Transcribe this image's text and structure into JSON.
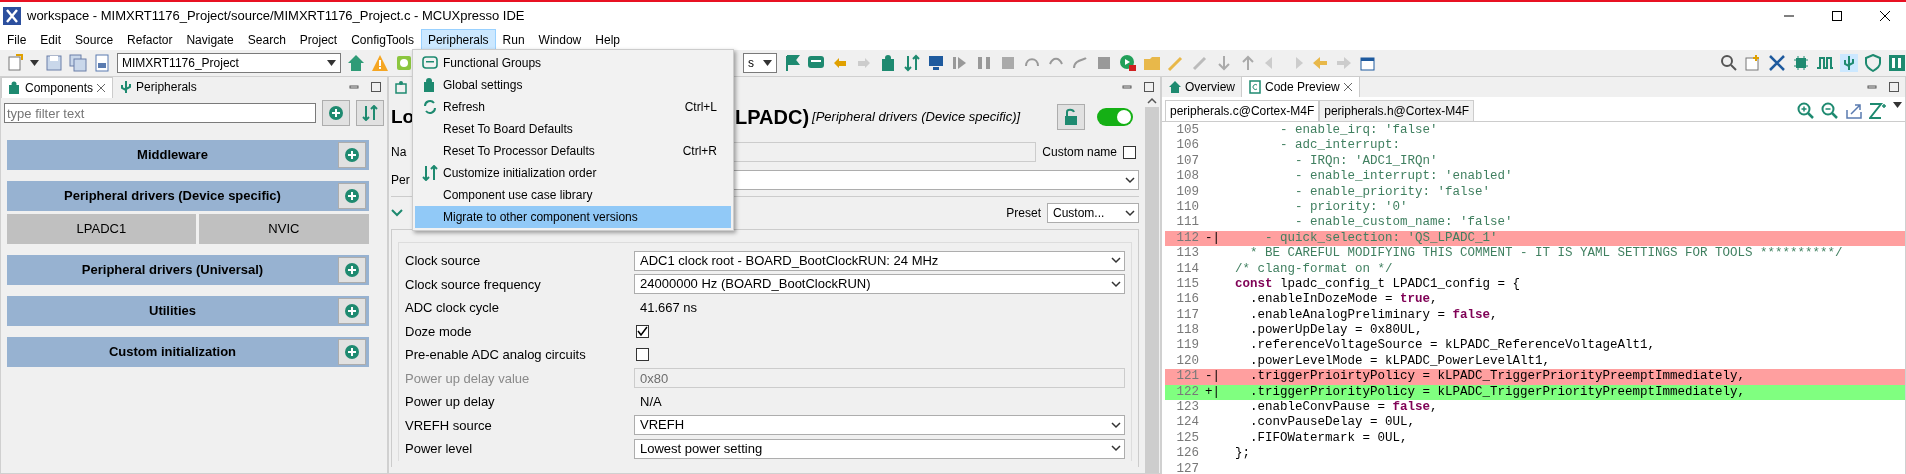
{
  "window": {
    "title": "workspace - MIMXRT1176_Project/source/MIMXRT1176_Project.c - MCUXpresso IDE"
  },
  "menu_bar": [
    {
      "label": "File",
      "selected": false
    },
    {
      "label": "Edit",
      "selected": false
    },
    {
      "label": "Source",
      "selected": false
    },
    {
      "label": "Refactor",
      "selected": false
    },
    {
      "label": "Navigate",
      "selected": false
    },
    {
      "label": "Search",
      "selected": false
    },
    {
      "label": "Project",
      "selected": false
    },
    {
      "label": "ConfigTools",
      "selected": false
    },
    {
      "label": "Peripherals",
      "selected": true
    },
    {
      "label": "Run",
      "selected": false
    },
    {
      "label": "Window",
      "selected": false
    },
    {
      "label": "Help",
      "selected": false
    }
  ],
  "toolbar": {
    "project_combo": "MIMXRT1176_Project",
    "second_combo": "s"
  },
  "open_menu": {
    "items": [
      {
        "label": "Functional Groups",
        "selected": false
      },
      {
        "label": "Global settings",
        "selected": false
      },
      {
        "label": "Refresh",
        "shortcut": "Ctrl+L",
        "selected": false
      },
      {
        "label": "Reset To Board Defaults",
        "selected": false
      },
      {
        "label": "Reset To Processor Defaults",
        "shortcut": "Ctrl+R",
        "selected": false
      },
      {
        "label": "Customize initialization order",
        "selected": false
      },
      {
        "label": "Component use case library",
        "selected": false
      },
      {
        "label": "Migrate to other component versions",
        "selected": true
      }
    ]
  },
  "components_view": {
    "tabs": [
      {
        "label": "Components",
        "selected": true
      },
      {
        "label": "Peripherals",
        "selected": false
      }
    ],
    "filter": {
      "placeholder": "type filter text"
    },
    "sections": [
      {
        "title": "Middleware"
      },
      {
        "title": "Peripheral drivers (Device specific)",
        "children": [
          {
            "label": "LPADC1"
          },
          {
            "label": "NVIC"
          }
        ]
      },
      {
        "title": "Peripheral drivers (Universal)"
      },
      {
        "title": "Utilities"
      },
      {
        "title": "Custom initialization"
      }
    ]
  },
  "editor": {
    "heading_start": "Lo",
    "heading_end": "LPADC)",
    "heading_category": "[Peripheral drivers (Device specific)]",
    "enabled": true,
    "name_label": "Na",
    "custom_name": {
      "label": "Custom name",
      "checked": false
    },
    "peripheral_label": "Per",
    "preset": {
      "label": "Preset",
      "value": "Custom..."
    },
    "settings": [
      {
        "kind": "select",
        "label": "Clock source",
        "value": "ADC1 clock root - BOARD_BootClockRUN: 24 MHz",
        "disabled": false
      },
      {
        "kind": "select",
        "label": "Clock source frequency",
        "value": "24000000 Hz (BOARD_BootClockRUN)",
        "disabled": false
      },
      {
        "kind": "text",
        "label": "ADC clock cycle",
        "value": "41.667 ns",
        "disabled": false
      },
      {
        "kind": "checkbox",
        "label": "Doze mode",
        "checked": true,
        "disabled": false
      },
      {
        "kind": "checkbox",
        "label": "Pre-enable ADC analog circuits",
        "checked": false,
        "disabled": false
      },
      {
        "kind": "input",
        "label": "Power up delay value",
        "value": "0x80",
        "disabled": true
      },
      {
        "kind": "text",
        "label": "Power up delay",
        "value": "N/A",
        "disabled": false
      },
      {
        "kind": "select",
        "label": "VREFH source",
        "value": "VREFH",
        "disabled": false
      },
      {
        "kind": "select",
        "label": "Power level",
        "value": "Lowest power setting",
        "disabled": false
      }
    ]
  },
  "code_preview": {
    "tabs": [
      {
        "label": "Overview",
        "selected": false
      },
      {
        "label": "Code Preview",
        "selected": true
      }
    ],
    "file_tabs": [
      {
        "label": "peripherals.c@Cortex-M4F",
        "selected": true
      },
      {
        "label": "peripherals.h@Cortex-M4F",
        "selected": false
      }
    ],
    "lines": [
      {
        "number": "105",
        "kind": "context",
        "parts": [
          {
            "text": "      - enable_irq: 'false'",
            "kind": "comment"
          }
        ]
      },
      {
        "number": "106",
        "kind": "context",
        "parts": [
          {
            "text": "      - adc_interrupt:",
            "kind": "comment"
          }
        ]
      },
      {
        "number": "107",
        "kind": "context",
        "parts": [
          {
            "text": "        - IRQn: 'ADC1_IRQn'",
            "kind": "comment"
          }
        ]
      },
      {
        "number": "108",
        "kind": "context",
        "parts": [
          {
            "text": "        - enable_interrupt: 'enabled'",
            "kind": "comment"
          }
        ]
      },
      {
        "number": "109",
        "kind": "context",
        "parts": [
          {
            "text": "        - enable_priority: 'false'",
            "kind": "comment"
          }
        ]
      },
      {
        "number": "110",
        "kind": "context",
        "parts": [
          {
            "text": "        - priority: '0'",
            "kind": "comment"
          }
        ]
      },
      {
        "number": "111",
        "kind": "context",
        "parts": [
          {
            "text": "        - enable_custom_name: 'false'",
            "kind": "comment"
          }
        ]
      },
      {
        "number": "112",
        "kind": "removed",
        "marker": "-|",
        "parts": [
          {
            "text": "    - quick_selection: 'QS_LPADC_1'",
            "kind": "comment"
          }
        ]
      },
      {
        "number": "113",
        "kind": "context",
        "parts": [
          {
            "text": "  * BE CAREFUL MODIFYING THIS COMMENT - IT IS YAML SETTINGS FOR TOOLS **********/",
            "kind": "comment"
          }
        ]
      },
      {
        "number": "114",
        "kind": "context",
        "parts": [
          {
            "text": "/* clang-format on */",
            "kind": "comment"
          }
        ]
      },
      {
        "number": "115",
        "kind": "context",
        "parts": [
          {
            "text": "const",
            "kind": "keyword"
          },
          {
            "text": " lpadc_config_t LPADC1_config = {",
            "kind": "plain"
          }
        ]
      },
      {
        "number": "116",
        "kind": "context",
        "parts": [
          {
            "text": "  .enableInDozeMode = ",
            "kind": "plain"
          },
          {
            "text": "true",
            "kind": "keyword"
          },
          {
            "text": ",",
            "kind": "plain"
          }
        ]
      },
      {
        "number": "117",
        "kind": "context",
        "parts": [
          {
            "text": "  .enableAnalogPreliminary = ",
            "kind": "plain"
          },
          {
            "text": "false",
            "kind": "keyword"
          },
          {
            "text": ",",
            "kind": "plain"
          }
        ]
      },
      {
        "number": "118",
        "kind": "context",
        "parts": [
          {
            "text": "  .powerUpDelay = 0x80UL,",
            "kind": "plain"
          }
        ]
      },
      {
        "number": "119",
        "kind": "context",
        "parts": [
          {
            "text": "  .referenceVoltageSource = kLPADC_ReferenceVoltageAlt1,",
            "kind": "plain"
          }
        ]
      },
      {
        "number": "120",
        "kind": "context",
        "parts": [
          {
            "text": "  .powerLevelMode = kLPADC_PowerLevelAlt1,",
            "kind": "plain"
          }
        ]
      },
      {
        "number": "121",
        "kind": "removed",
        "marker": "-|",
        "parts": [
          {
            "text": "  .triggerPrioirtyPolicy = kLPADC_TriggerPriorityPreemptImmediately,",
            "kind": "plain"
          }
        ]
      },
      {
        "number": "122",
        "kind": "added",
        "marker": "+|",
        "parts": [
          {
            "text": "  .triggerPriorityPolicy = kLPADC_TriggerPriorityPreemptImmediately,",
            "kind": "plain"
          }
        ]
      },
      {
        "number": "123",
        "kind": "context",
        "parts": [
          {
            "text": "  .enableConvPause = ",
            "kind": "plain"
          },
          {
            "text": "false",
            "kind": "keyword"
          },
          {
            "text": ",",
            "kind": "plain"
          }
        ]
      },
      {
        "number": "124",
        "kind": "context",
        "parts": [
          {
            "text": "  .convPauseDelay = 0UL,",
            "kind": "plain"
          }
        ]
      },
      {
        "number": "125",
        "kind": "context",
        "parts": [
          {
            "text": "  .FIFOWatermark = 0UL,",
            "kind": "plain"
          }
        ]
      },
      {
        "number": "126",
        "kind": "context",
        "parts": [
          {
            "text": "};",
            "kind": "plain"
          }
        ]
      },
      {
        "number": "127",
        "kind": "context"
      }
    ]
  }
}
